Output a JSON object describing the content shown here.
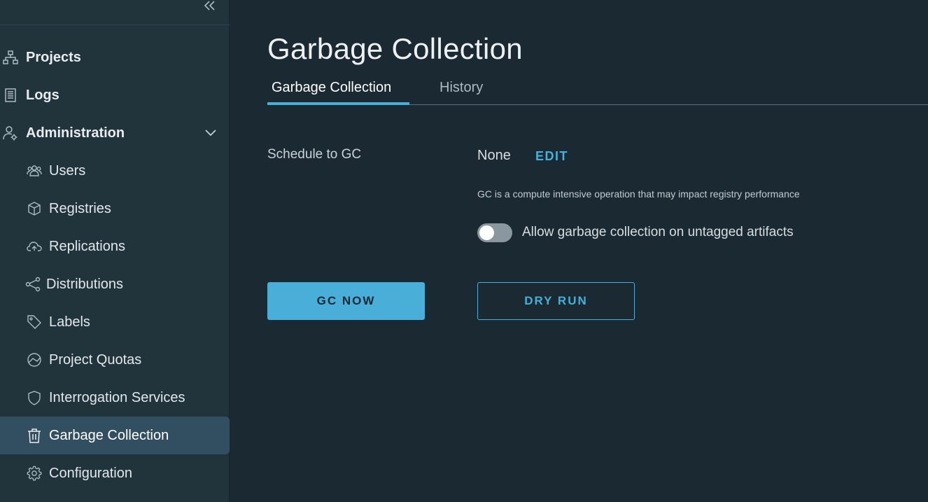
{
  "sidebar": {
    "top_items": [
      {
        "label": "Projects",
        "icon": "projects-icon"
      },
      {
        "label": "Logs",
        "icon": "logs-icon"
      },
      {
        "label": "Administration",
        "icon": "administration-icon"
      }
    ],
    "sub_items": [
      {
        "label": "Users",
        "icon": "users-icon"
      },
      {
        "label": "Registries",
        "icon": "registries-icon"
      },
      {
        "label": "Replications",
        "icon": "replications-icon"
      },
      {
        "label": "Distributions",
        "icon": "distributions-icon"
      },
      {
        "label": "Labels",
        "icon": "labels-icon"
      },
      {
        "label": "Project Quotas",
        "icon": "project-quotas-icon"
      },
      {
        "label": "Interrogation Services",
        "icon": "interrogation-services-icon"
      },
      {
        "label": "Garbage Collection",
        "icon": "trash-icon",
        "active": true
      },
      {
        "label": "Configuration",
        "icon": "gear-icon"
      }
    ]
  },
  "main": {
    "title": "Garbage Collection",
    "tabs": [
      {
        "label": "Garbage Collection",
        "active": true
      },
      {
        "label": "History",
        "active": false
      }
    ],
    "schedule": {
      "label": "Schedule to GC",
      "value": "None",
      "edit_label": "EDIT"
    },
    "hint": "GC is a compute intensive operation that may impact registry performance",
    "toggle": {
      "label": "Allow garbage collection on untagged artifacts",
      "on": false
    },
    "buttons": {
      "gc_now": "GC NOW",
      "dry_run": "DRY RUN"
    }
  },
  "colors": {
    "accent": "#49afd9",
    "sidebar_bg": "#21333b",
    "main_bg": "#1b2a32",
    "active_bg": "#324f61"
  }
}
